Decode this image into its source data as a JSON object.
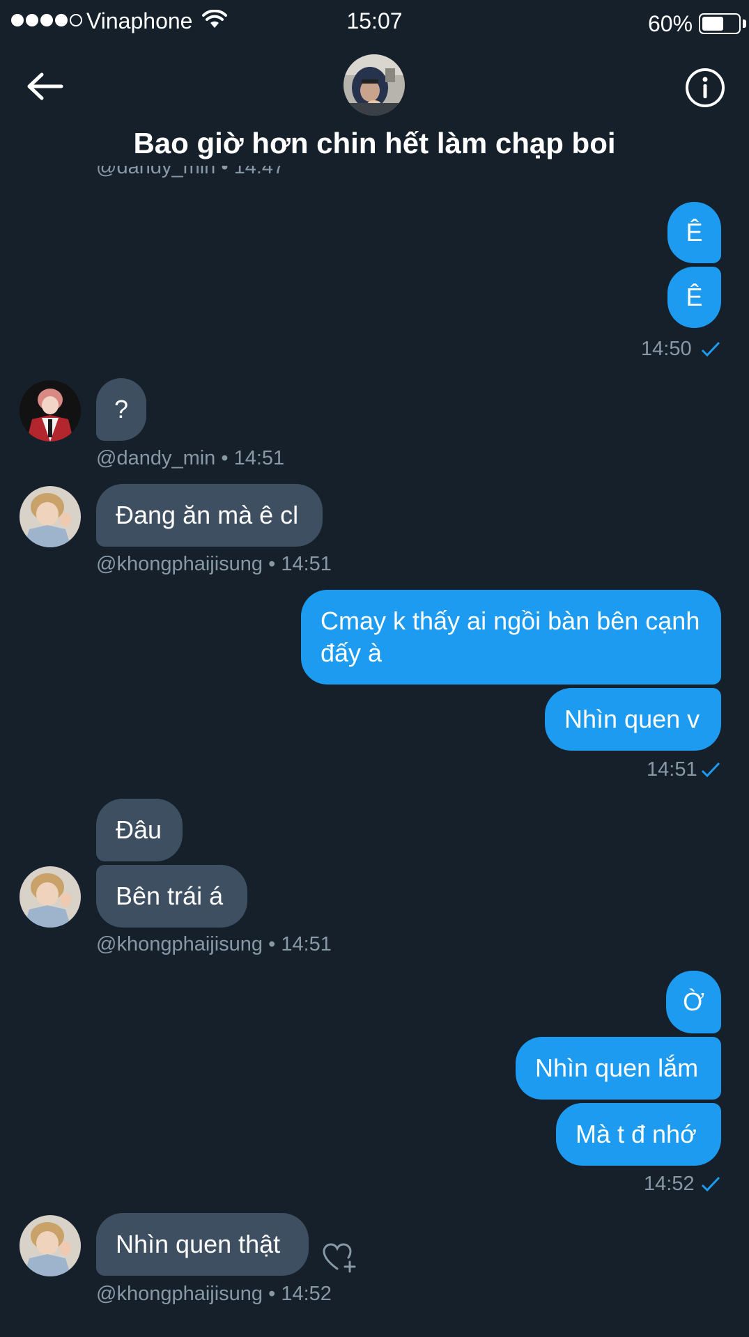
{
  "status_bar": {
    "carrier": "Vinaphone",
    "time": "15:07",
    "battery_percent": "60%",
    "battery_level": 0.6,
    "signal_bars": 4,
    "signal_total": 5
  },
  "header": {
    "title": "Bao giờ hơn chin hết làm chạp boi",
    "back_icon": "arrow-left-icon",
    "info_icon": "info-circle-icon"
  },
  "clipped_meta": "@dandy_min • 14:47",
  "messages": [
    {
      "id": "m1",
      "dir": "out",
      "text": "Ê"
    },
    {
      "id": "m2",
      "dir": "out",
      "text": "Ê"
    },
    {
      "id": "m3",
      "dir": "in",
      "text": "?"
    },
    {
      "id": "m4",
      "dir": "in",
      "text": "Đang ăn mà ê cl"
    },
    {
      "id": "m5",
      "dir": "out",
      "text": "Cmay k thấy ai ngồi bàn bên cạnh đấy à"
    },
    {
      "id": "m6",
      "dir": "out",
      "text": "Nhìn quen v"
    },
    {
      "id": "m7",
      "dir": "in",
      "text": "Đâu"
    },
    {
      "id": "m8",
      "dir": "in",
      "text": "Bên trái á"
    },
    {
      "id": "m9",
      "dir": "out",
      "text": "Ờ"
    },
    {
      "id": "m10",
      "dir": "out",
      "text": "Nhìn quen lắm"
    },
    {
      "id": "m11",
      "dir": "out",
      "text": "Mà t đ nhớ"
    },
    {
      "id": "m12",
      "dir": "in",
      "text": "Nhìn quen thật"
    }
  ],
  "meta": {
    "out1_time": "14:50",
    "in1": "@dandy_min • 14:51",
    "in2": "@khongphaijisung • 14:51",
    "out2_time": "14:51",
    "in3": "@khongphaijisung • 14:51",
    "out3_time": "14:52",
    "in4": "@khongphaijisung • 14:52"
  },
  "colors": {
    "background": "#15202b",
    "outgoing_bubble": "#1d9bf0",
    "incoming_bubble": "#3d4f60",
    "meta_text": "#8899a6",
    "read_check": "#1d9bf0"
  },
  "icons": {
    "read_receipt": "check-icon",
    "react": "heart-plus-icon",
    "wifi": "wifi-icon",
    "battery": "battery-icon"
  }
}
